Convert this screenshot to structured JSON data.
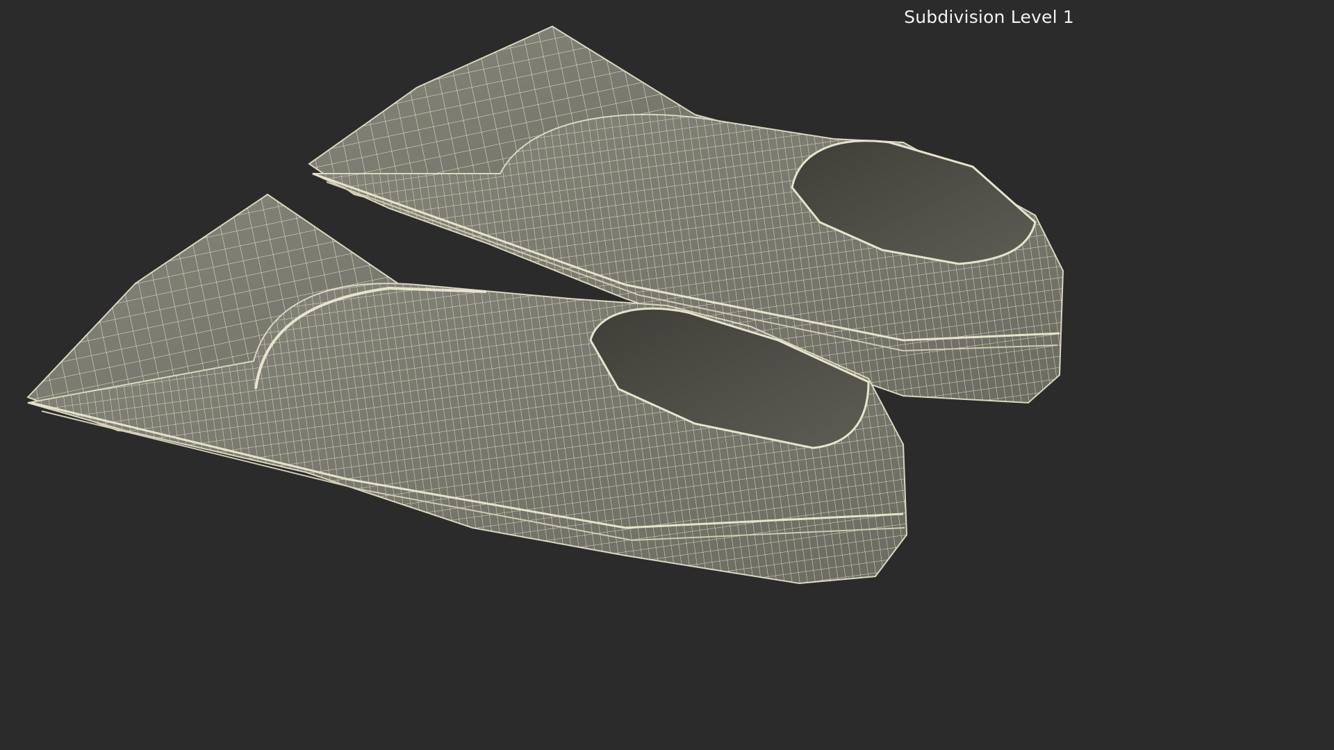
{
  "viewport": {
    "label": "Subdivision Level 1",
    "background": "#2b2b2b"
  },
  "model": {
    "count": 2,
    "surface_color": "#7d7d71",
    "shadow_color": "#5a5a50",
    "inner_color": "#4d4d45",
    "wire_color": "#f3efd8"
  }
}
